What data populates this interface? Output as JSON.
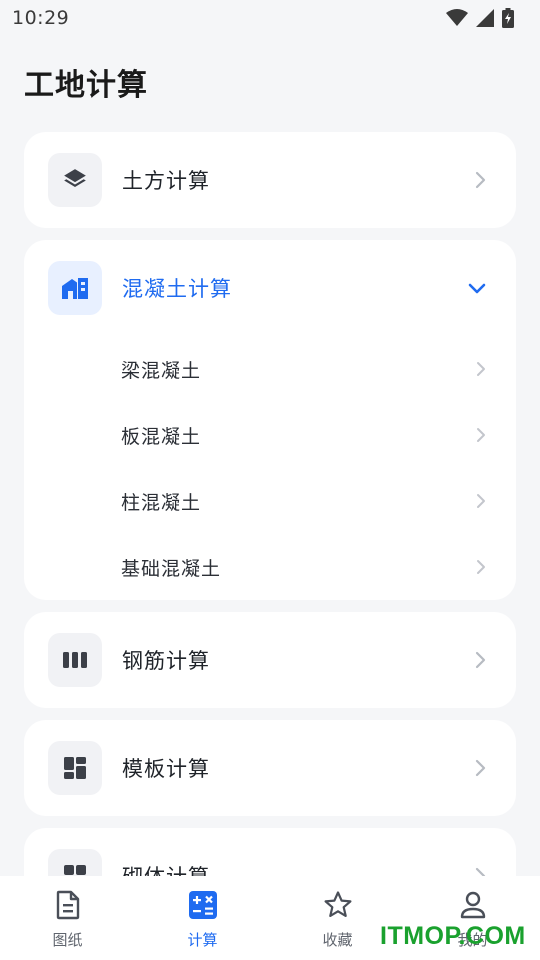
{
  "status_bar": {
    "time": "10:29",
    "icons": [
      "wifi-icon",
      "signal-icon",
      "battery-charging-icon"
    ]
  },
  "page": {
    "title": "工地计算"
  },
  "categories": [
    {
      "label": "土方计算",
      "icon": "layers-icon"
    },
    {
      "label": "混凝土计算",
      "icon": "building-icon",
      "expanded": true,
      "sub_items": [
        {
          "label": "梁混凝土"
        },
        {
          "label": "板混凝土"
        },
        {
          "label": "柱混凝土"
        },
        {
          "label": "基础混凝土"
        }
      ]
    },
    {
      "label": "钢筋计算",
      "icon": "rebar-icon"
    },
    {
      "label": "模板计算",
      "icon": "formwork-icon"
    },
    {
      "label": "砌体计算",
      "icon": "masonry-icon"
    }
  ],
  "bottom_nav": [
    {
      "label": "图纸",
      "icon": "document-icon",
      "active": false
    },
    {
      "label": "计算",
      "icon": "calculator-icon",
      "active": true
    },
    {
      "label": "收藏",
      "icon": "star-icon",
      "active": false
    },
    {
      "label": "我的",
      "icon": "person-icon",
      "active": false
    }
  ],
  "watermark": "ITMOP.COM",
  "colors": {
    "accent": "#1f6bf0",
    "background": "#f5f6f8",
    "card": "#ffffff",
    "watermark": "#1aa12e"
  }
}
